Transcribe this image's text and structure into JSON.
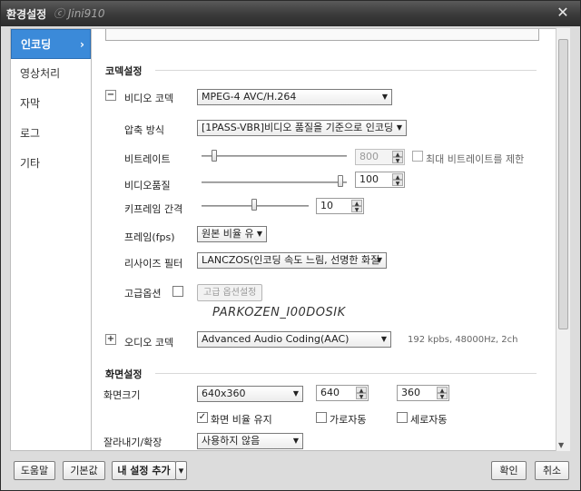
{
  "window": {
    "title": "환경설정",
    "watermark": "ⓒ Jini910",
    "close": "✕"
  },
  "sidebar": {
    "items": [
      {
        "label": "인코딩",
        "chev": "›"
      },
      {
        "label": "영상처리"
      },
      {
        "label": "자막"
      },
      {
        "label": "로그"
      },
      {
        "label": "기타"
      }
    ]
  },
  "codec": {
    "section_title": "코덱설정",
    "video": {
      "toggle": "−",
      "label": "비디오 코덱",
      "value": "MPEG-4 AVC/H.264",
      "compress_label": "압축 방식",
      "compress_value": "[1PASS-VBR]비디오 품질을 기준으로 인코딩",
      "bitrate_label": "비트레이트",
      "bitrate_value": "800",
      "bitrate_limit_label": "최대 비트레이트를 제한",
      "quality_label": "비디오품질",
      "quality_value": "100",
      "keyframe_label": "키프레임 간격",
      "keyframe_value": "10",
      "fps_label": "프레임(fps)",
      "fps_value": "원본 비율 유",
      "resize_label": "리사이즈 필터",
      "resize_value": "LANCZOS(인코딩 속도 느림, 선명한 화질",
      "advanced_label": "고급옵션",
      "advanced_button": "고급 옵션설정"
    },
    "overlay_text": "PARKOZEN_I00DOSIK",
    "audio": {
      "toggle": "+",
      "label": "오디오 코덱",
      "value": "Advanced Audio Coding(AAC)",
      "info": "192 kpbs, 48000Hz, 2ch"
    }
  },
  "screen": {
    "section_title": "화면설정",
    "size_label": "화면크기",
    "size_value": "640x360",
    "width_value": "640",
    "height_value": "360",
    "keep_ratio_label": "화면 비율 유지",
    "keep_ratio_check": "✓",
    "auto_width_label": "가로자동",
    "auto_height_label": "세로자동",
    "crop_label": "잘라내기/확장",
    "crop_value": "사용하지 않음"
  },
  "footer": {
    "help": "도움말",
    "default": "기본값",
    "add_preset": "내 설정 추가",
    "add_preset_arrow": "▾",
    "ok": "확인",
    "cancel": "취소"
  },
  "glyphs": {
    "dropdown": "▼",
    "up": "▲",
    "down": "▼"
  }
}
